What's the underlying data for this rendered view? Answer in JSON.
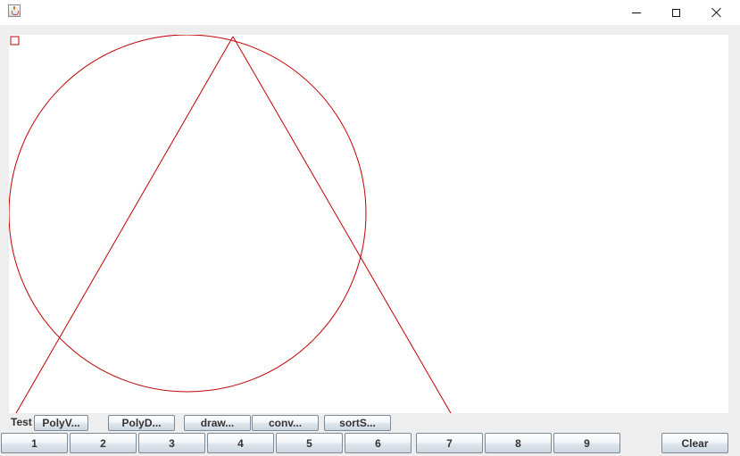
{
  "window": {
    "icon": "java-cup-icon",
    "controls": [
      "minimize-icon",
      "maximize-icon",
      "close-icon"
    ]
  },
  "canvas": {
    "stroke_color": "#c00000",
    "background": "#ffffff"
  },
  "test_panel": {
    "label": "Test",
    "buttons": [
      "PolyV...",
      "PolyD...",
      "draw...",
      "conv...",
      "sortS..."
    ]
  },
  "number_panel": {
    "buttons": [
      "1",
      "2",
      "3",
      "4",
      "5",
      "6",
      "7",
      "8",
      "9"
    ],
    "clear_label": "Clear"
  }
}
